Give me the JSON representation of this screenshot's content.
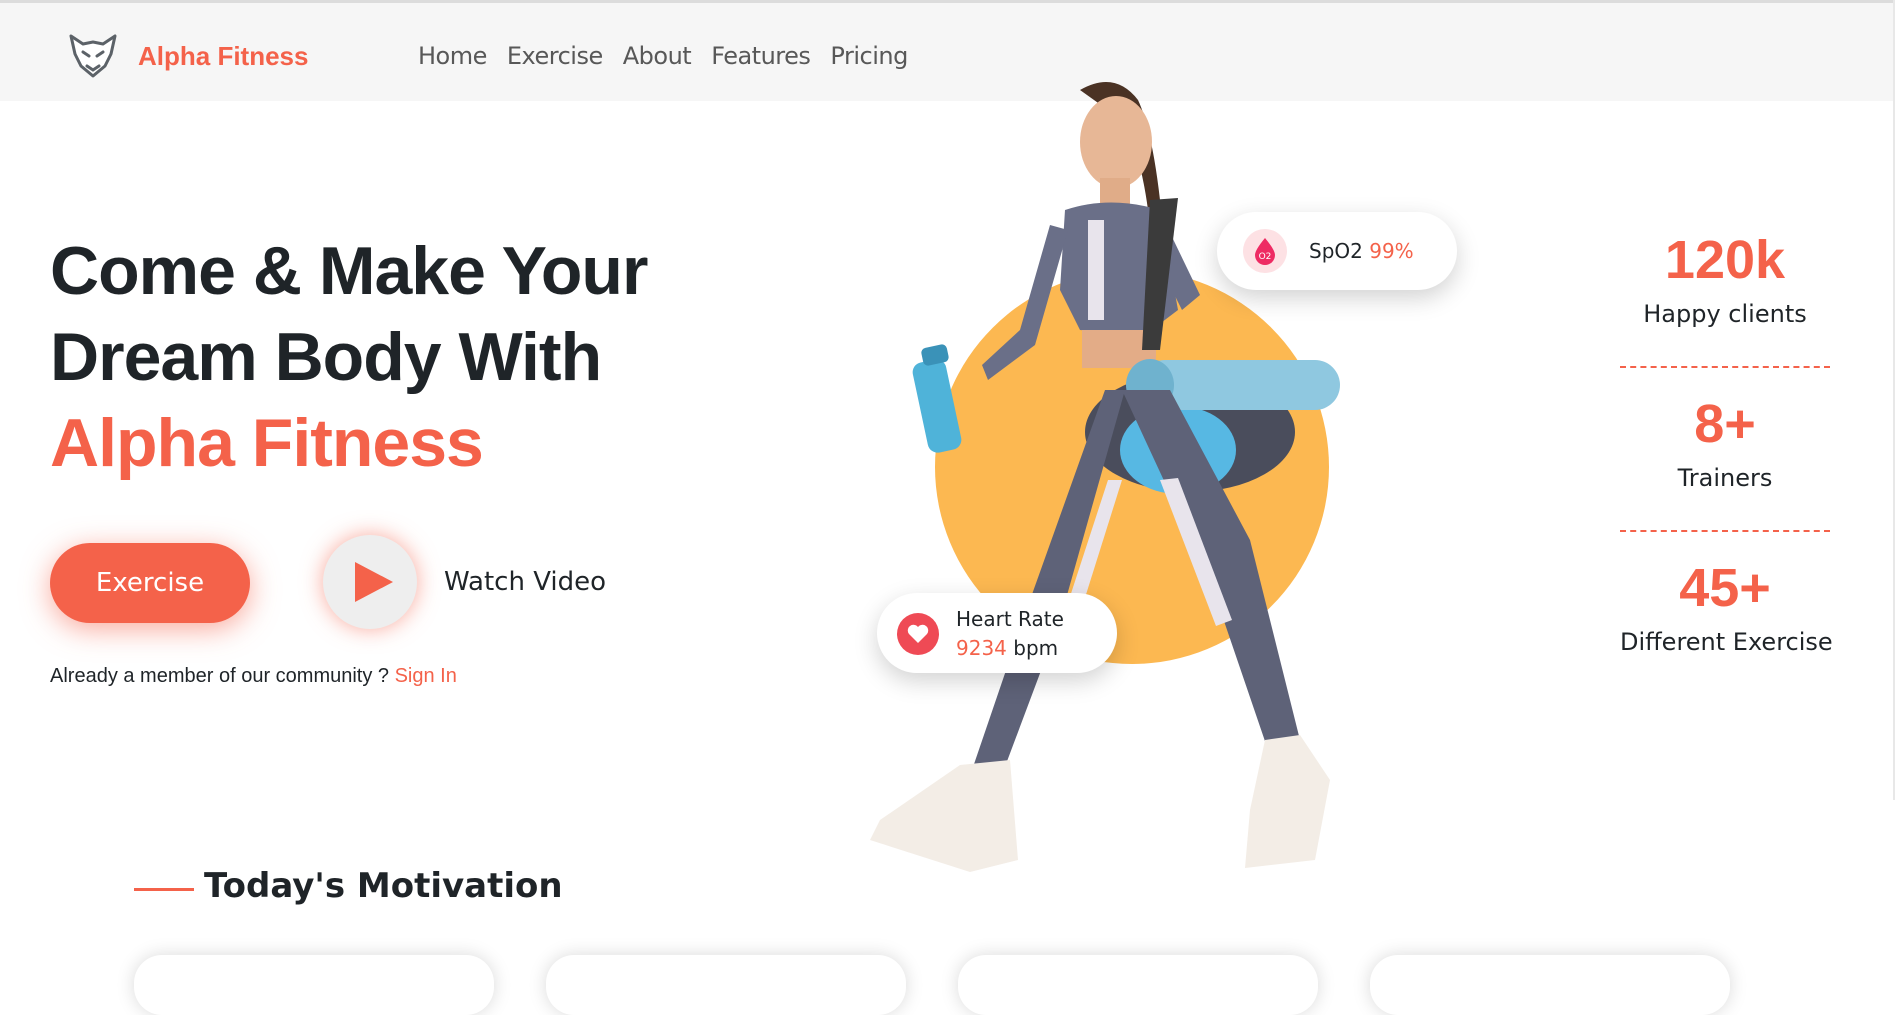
{
  "brand": {
    "name": "Alpha Fitness",
    "logo_icon": "wolf-logo-icon"
  },
  "nav": {
    "items": [
      "Home",
      "Exercise",
      "About",
      "Features",
      "Pricing"
    ]
  },
  "hero": {
    "headline_line1": "Come & Make Your",
    "headline_line2": "Dream Body With",
    "headline_accent": "Alpha Fitness",
    "exercise_button": "Exercise",
    "watch_video": "Watch Video",
    "member_prompt": "Already a member of our community ?",
    "sign_in": "Sign In"
  },
  "widgets": {
    "spo2": {
      "label": "SpO2",
      "value": "99%",
      "icon": "oxygen-drop-icon"
    },
    "heart_rate": {
      "label": "Heart Rate",
      "value": "9234",
      "unit": "bpm",
      "icon": "heart-icon"
    }
  },
  "stats": [
    {
      "value": "120k",
      "label": "Happy clients"
    },
    {
      "value": "8+",
      "label": "Trainers"
    },
    {
      "value": "45+",
      "label": "Different Exercise"
    }
  ],
  "motivation": {
    "title": "Today's Motivation"
  },
  "colors": {
    "accent": "#f4624a",
    "circle": "#fcb851",
    "heart": "#ef4a55"
  }
}
